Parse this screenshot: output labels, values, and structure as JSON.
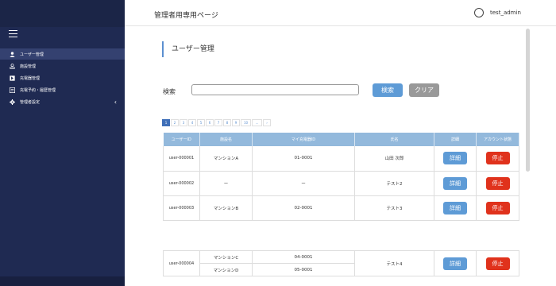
{
  "header": {
    "title": "管理者用専用ページ",
    "username": "test_admin"
  },
  "sidebar": {
    "items": [
      {
        "label": "ユーザー管理",
        "icon": "user-icon",
        "active": true
      },
      {
        "label": "施設管理",
        "icon": "facility-icon",
        "active": false
      },
      {
        "label": "充電器管理",
        "icon": "charger-icon",
        "active": false
      },
      {
        "label": "充電予約・履歴管理",
        "icon": "reservation-icon",
        "active": false
      },
      {
        "label": "管理者設定",
        "icon": "gear-icon",
        "active": false
      }
    ]
  },
  "main": {
    "heading": "ユーザー管理",
    "search": {
      "label": "検索",
      "value": "",
      "placeholder": "",
      "search_button": "検索",
      "clear_button": "クリア"
    },
    "pagination": [
      "1",
      "2",
      "3",
      "4",
      "5",
      "6",
      "7",
      "8",
      "9",
      "10",
      "...",
      "›"
    ],
    "table": {
      "columns": [
        "ユーザーID",
        "施設名",
        "マイ充電器ID",
        "氏名",
        "詳細",
        "アカウント状態"
      ],
      "detail_label": "詳細",
      "stop_label": "停止",
      "rows": [
        {
          "user_id": "user-000001",
          "facility": "マンションA",
          "charger_id": "01-0001",
          "name": "山田 次郎"
        },
        {
          "user_id": "user-000002",
          "facility": "ー",
          "charger_id": "ー",
          "name": "テスト2"
        },
        {
          "user_id": "user-000003",
          "facility": "マンションB",
          "charger_id": "02-0001",
          "name": "テスト3"
        }
      ],
      "multi_row": {
        "user_id": "user-000004",
        "facilities": [
          "マンションC",
          "マンションD"
        ],
        "charger_ids": [
          "04-0001",
          "05-0001"
        ],
        "name": "テスト4"
      }
    }
  },
  "colors": {
    "sidebar_bg": "#1f2a52",
    "sidebar_active": "#344170",
    "table_header": "#93b9dc",
    "primary_button": "#5e9bd6",
    "danger_button": "#e0321c",
    "clear_button": "#999999"
  }
}
